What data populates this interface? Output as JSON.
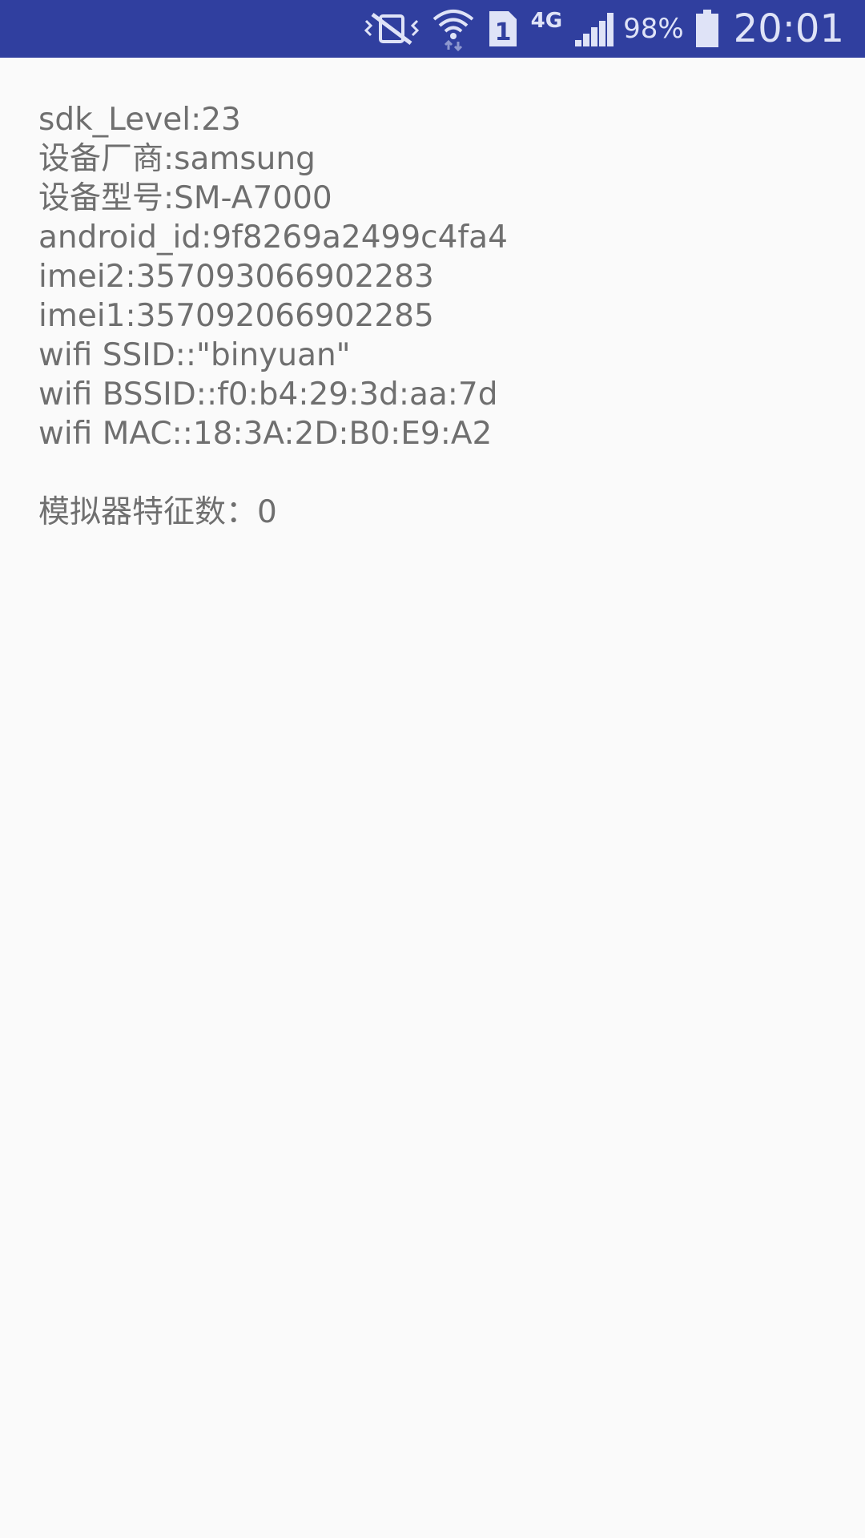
{
  "status_bar": {
    "icons": [
      "vibrate-mute-icon",
      "wifi-icon",
      "sim-1-icon",
      "signal-icon",
      "battery-icon"
    ],
    "network_type": "4G",
    "battery_percent": "98%",
    "time": "20:01",
    "background_color": "#303f9f",
    "foreground_color": "#dfe3f7"
  },
  "content": {
    "text_color": "#6f6f6f",
    "lines": [
      "sdk_Level:23",
      "设备厂商:samsung",
      "设备型号:SM-A7000",
      "android_id:9f8269a2499c4fa4",
      "imei2:357093066902283",
      "imei1:357092066902285",
      "wifi SSID::\"binyuan\"",
      "wifi BSSID::f0:b4:29:3d:aa:7d",
      "wifi MAC::18:3A:2D:B0:E9:A2"
    ],
    "emulator_line": "模拟器特征数：0"
  }
}
